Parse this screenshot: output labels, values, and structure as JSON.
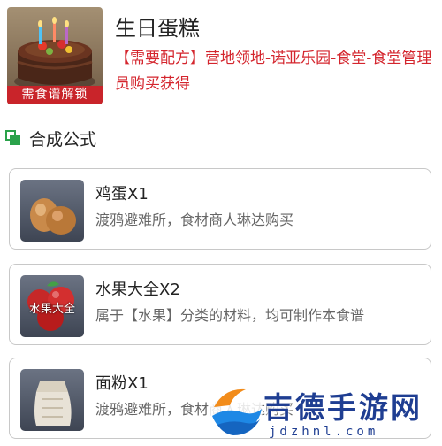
{
  "item": {
    "name": "生日蛋糕",
    "unlock_tag": "需食谱解锁",
    "recipe_source": "【需要配方】营地领地-诺亚乐园-食堂-食堂管理员购买获得"
  },
  "section": {
    "title": "合成公式"
  },
  "ingredients": [
    {
      "name": "鸡蛋X1",
      "desc": "渡鸦避难所，食材商人琳达购买",
      "icon": "egg-icon"
    },
    {
      "name": "水果大全X2",
      "desc": "属于【水果】分类的材料，均可制作本食谱",
      "icon": "fruit-icon",
      "thumb_caption": "水果大全"
    },
    {
      "name": "面粉X1",
      "desc": "渡鸦避难所，食材商人琳达购买",
      "icon": "flour-sack-icon"
    }
  ],
  "watermark": {
    "text": "吉德手游网",
    "url": "jdzhnl.com"
  },
  "colors": {
    "accent_red": "#d4252d",
    "section_green": "#2aa24a",
    "watermark_blue": "#1f3e92"
  }
}
